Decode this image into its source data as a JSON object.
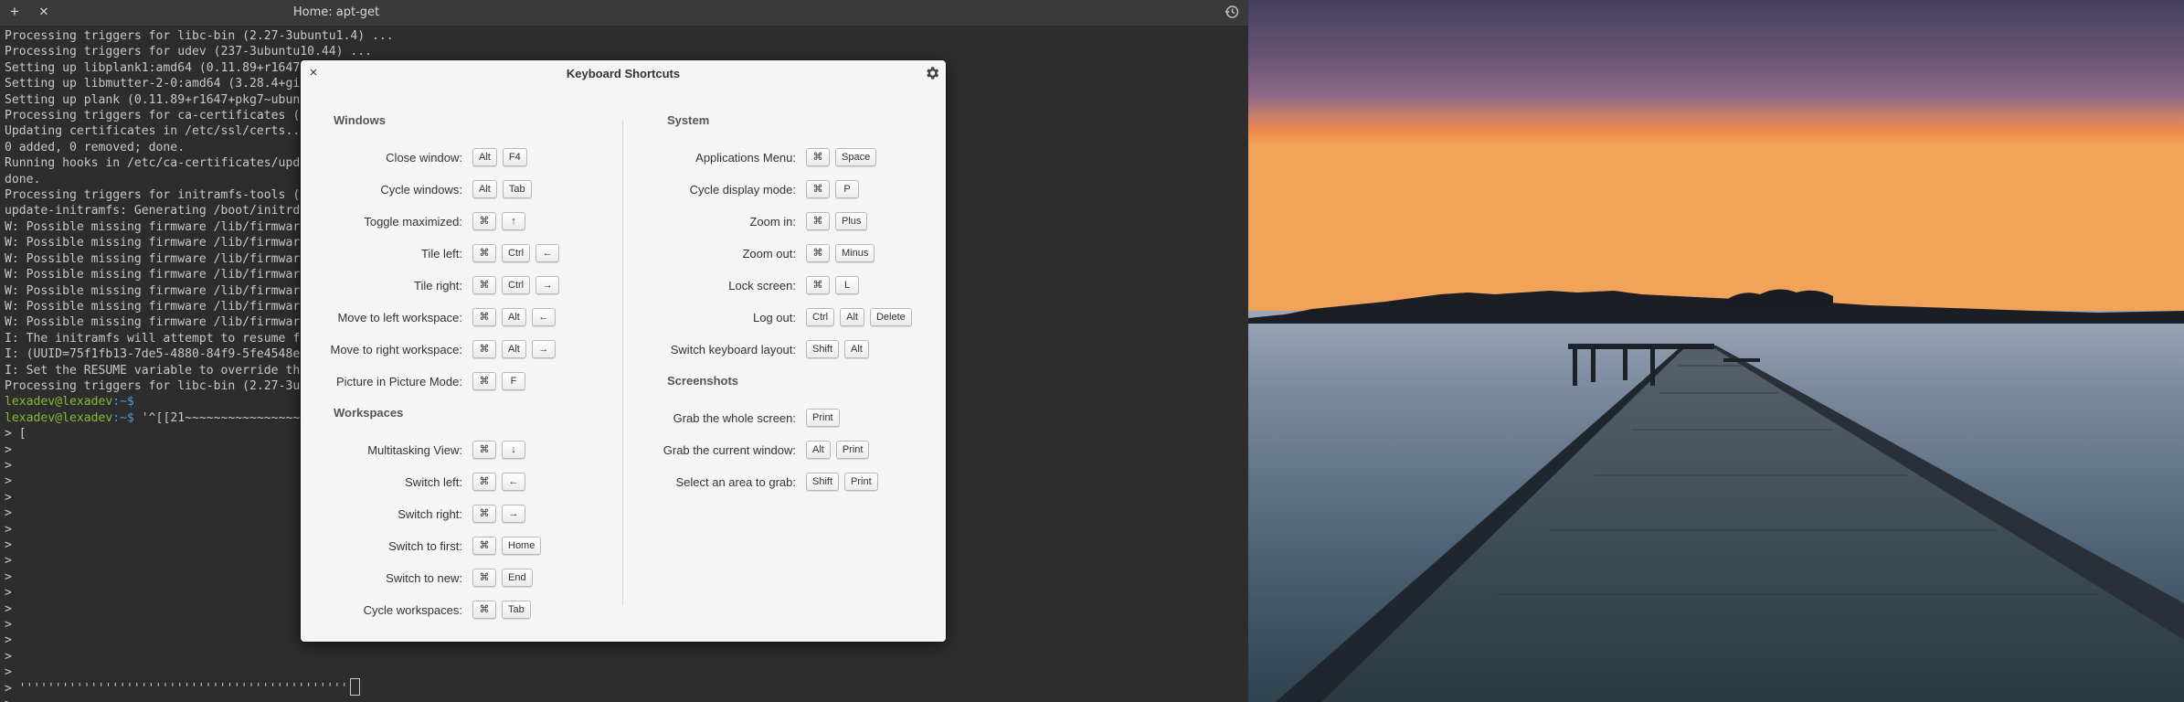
{
  "terminal": {
    "title": "Home: apt-get",
    "new_tab_label": "+",
    "close_tab_label": "✕",
    "lines": [
      "Processing triggers for libc-bin (2.27-3ubuntu1.4) ...",
      "Processing triggers for udev (237-3ubuntu10.44) ...",
      "Setting up libplank1:amd64 (0.11.89+r1647",
      "Setting up libmutter-2-0:amd64 (3.28.4+gi",
      "Setting up plank (0.11.89+r1647+pkg7~ubun",
      "Processing triggers for ca-certificates (",
      "Updating certificates in /etc/ssl/certs..",
      "0 added, 0 removed; done.",
      "Running hooks in /etc/ca-certificates/upd",
      "done.",
      "Processing triggers for initramfs-tools (",
      "update-initramfs: Generating /boot/initrd",
      "W: Possible missing firmware /lib/firmwar",
      "W: Possible missing firmware /lib/firmwar",
      "W: Possible missing firmware /lib/firmwar",
      "W: Possible missing firmware /lib/firmwar",
      "W: Possible missing firmware /lib/firmwar",
      "W: Possible missing firmware /lib/firmwar",
      "W: Possible missing firmware /lib/firmwar",
      "I: The initramfs will attempt to resume f",
      "I: (UUID=75f1fb13-7de5-4880-84f9-5fe4548e",
      "I: Set the RESUME variable to override th",
      "Processing triggers for libc-bin (2.27-3u"
    ],
    "prompt_user": "lexadev@lexadev",
    "prompt_path": ":~$",
    "prompt_command_2": " '^[[21~~~~~~~~~~~~~~~~~~~~~~~",
    "continuation_first": "> [",
    "continuation_marker": ">",
    "continuation_count": 17,
    "bottom_line": "  ''''''''''''''''''''''''''''''''''''''''''''''"
  },
  "dialog": {
    "title": "Keyboard Shortcuts",
    "close_label": "×",
    "left_sections": [
      {
        "title": "Windows",
        "rows": [
          {
            "label": "Close window:",
            "keys": [
              "Alt",
              "F4"
            ]
          },
          {
            "label": "Cycle windows:",
            "keys": [
              "Alt",
              "Tab"
            ]
          },
          {
            "label": "Toggle maximized:",
            "keys": [
              "⌘",
              "↑"
            ]
          },
          {
            "label": "Tile left:",
            "keys": [
              "⌘",
              "Ctrl",
              "←"
            ]
          },
          {
            "label": "Tile right:",
            "keys": [
              "⌘",
              "Ctrl",
              "→"
            ]
          },
          {
            "label": "Move to left workspace:",
            "keys": [
              "⌘",
              "Alt",
              "←"
            ]
          },
          {
            "label": "Move to right workspace:",
            "keys": [
              "⌘",
              "Alt",
              "→"
            ]
          },
          {
            "label": "Picture in Picture Mode:",
            "keys": [
              "⌘",
              "F"
            ]
          }
        ]
      },
      {
        "title": "Workspaces",
        "rows": [
          {
            "label": "Multitasking View:",
            "keys": [
              "⌘",
              "↓"
            ]
          },
          {
            "label": "Switch left:",
            "keys": [
              "⌘",
              "←"
            ]
          },
          {
            "label": "Switch right:",
            "keys": [
              "⌘",
              "→"
            ]
          },
          {
            "label": "Switch to first:",
            "keys": [
              "⌘",
              "Home"
            ]
          },
          {
            "label": "Switch to new:",
            "keys": [
              "⌘",
              "End"
            ]
          },
          {
            "label": "Cycle workspaces:",
            "keys": [
              "⌘",
              "Tab"
            ]
          }
        ]
      }
    ],
    "right_sections": [
      {
        "title": "System",
        "rows": [
          {
            "label": "Applications Menu:",
            "keys": [
              "⌘",
              "Space"
            ]
          },
          {
            "label": "Cycle display mode:",
            "keys": [
              "⌘",
              "P"
            ]
          },
          {
            "label": "Zoom in:",
            "keys": [
              "⌘",
              "Plus"
            ]
          },
          {
            "label": "Zoom out:",
            "keys": [
              "⌘",
              "Minus"
            ]
          },
          {
            "label": "Lock screen:",
            "keys": [
              "⌘",
              "L"
            ]
          },
          {
            "label": "Log out:",
            "keys": [
              "Ctrl",
              "Alt",
              "Delete"
            ]
          },
          {
            "label": "Switch keyboard layout:",
            "keys": [
              "Shift",
              "Alt"
            ]
          }
        ]
      },
      {
        "title": "Screenshots",
        "rows": [
          {
            "label": "Grab the whole screen:",
            "keys": [
              "Print"
            ]
          },
          {
            "label": "Grab the current window:",
            "keys": [
              "Alt",
              "Print"
            ]
          },
          {
            "label": "Select an area to grab:",
            "keys": [
              "Shift",
              "Print"
            ]
          }
        ]
      }
    ]
  },
  "icons": {
    "history": "history-icon",
    "settings": "gear-icon",
    "close": "close-icon",
    "new_tab": "plus-icon"
  },
  "colors": {
    "terminal_bg": "#2d2d2d",
    "prompt_user": "#8ab833",
    "prompt_path": "#4e9ad8",
    "dialog_bg": "#f5f5f5"
  }
}
